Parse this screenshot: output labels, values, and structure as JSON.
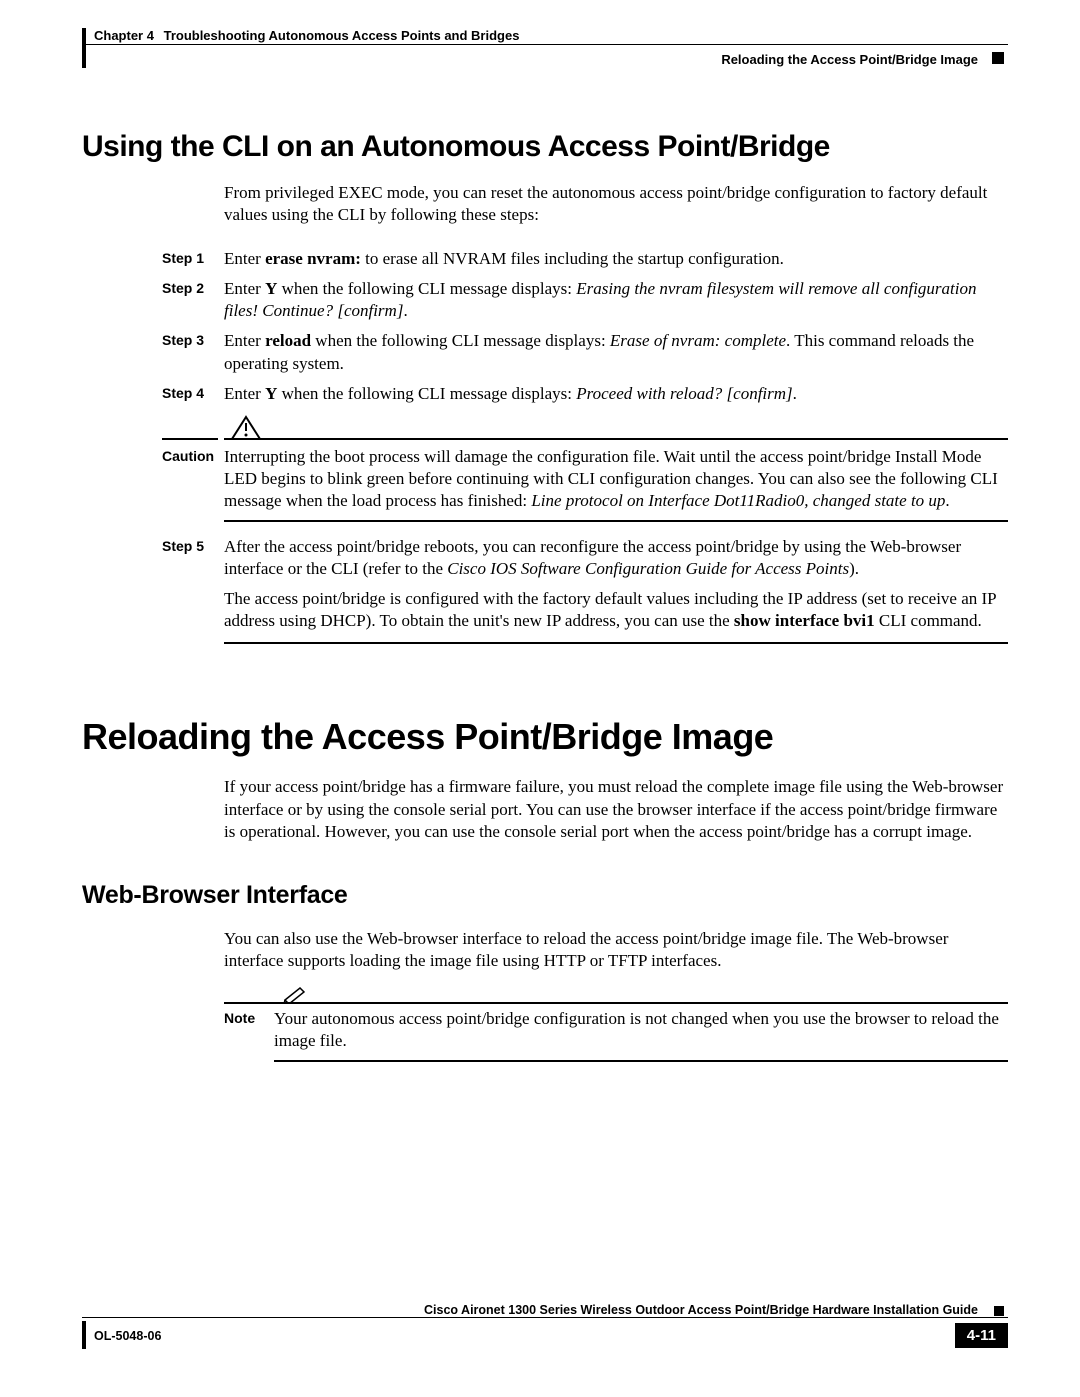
{
  "header": {
    "chapter_label": "Chapter 4",
    "chapter_title": "Troubleshooting Autonomous Access Points and Bridges",
    "section_title": "Reloading the Access Point/Bridge Image"
  },
  "section_cli": {
    "heading": "Using the CLI on an Autonomous Access Point/Bridge",
    "intro": "From privileged EXEC mode, you can reset the autonomous access point/bridge configuration to factory default values using the CLI by following these steps:",
    "steps": {
      "s1_label": "Step 1",
      "s1_a": "Enter ",
      "s1_b": "erase nvram:",
      "s1_c": " to erase all NVRAM files including the startup configuration.",
      "s2_label": "Step 2",
      "s2_a": "Enter ",
      "s2_y": "Y",
      "s2_b": " when the following CLI message displays: ",
      "s2_i": "Erasing the nvram filesystem will remove all configuration files! Continue? [confirm]",
      "s2_c": ".",
      "s3_label": "Step 3",
      "s3_a": "Enter ",
      "s3_b": "reload",
      "s3_c": " when the following CLI message displays: ",
      "s3_i": "Erase of nvram: complete",
      "s3_d": ". This command reloads the operating system.",
      "s4_label": "Step 4",
      "s4_a": "Enter ",
      "s4_y": "Y",
      "s4_b": " when the following CLI message displays: ",
      "s4_i": "Proceed with reload? [confirm]",
      "s4_c": "."
    },
    "caution": {
      "label": "Caution",
      "a": "Interrupting the boot process will damage the configuration file. Wait until the access point/bridge Install Mode LED begins to blink green before continuing with CLI configuration changes. You can also see the following CLI message when the load process has finished: ",
      "i": "Line protocol on Interface Dot11Radio0, changed state to up",
      "b": "."
    },
    "step5": {
      "label": "Step 5",
      "a": "After the access point/bridge reboots, you can reconfigure the access point/bridge by using the Web-browser interface or the CLI (refer to the ",
      "i": "Cisco IOS Software Configuration Guide for Access Points",
      "b": ")."
    },
    "poststep": {
      "a": "The access point/bridge is configured with the factory default values including the IP address (set to receive an IP address using DHCP). To obtain the unit's new IP address, you can use the ",
      "b": "show interface bvi1",
      "c": " CLI command."
    }
  },
  "section_reload": {
    "heading": "Reloading the Access Point/Bridge Image",
    "intro": "If your access point/bridge has a firmware failure, you must reload the complete image file using the Web-browser interface or by using the console serial port. You can use the browser interface if the access point/bridge firmware is operational. However, you can use the console serial port when the access point/bridge has a corrupt image."
  },
  "section_web": {
    "heading": "Web-Browser Interface",
    "intro": "You can also use the Web-browser interface to reload the access point/bridge image file. The Web-browser interface supports loading the image file using HTTP or TFTP interfaces.",
    "note": {
      "label": "Note",
      "body": "Your autonomous access point/bridge configuration is not changed when you use the browser to reload the image file."
    }
  },
  "footer": {
    "guide_title": "Cisco Aironet 1300 Series Wireless Outdoor Access Point/Bridge Hardware Installation Guide",
    "doc_id": "OL-5048-06",
    "page_num": "4-11"
  }
}
